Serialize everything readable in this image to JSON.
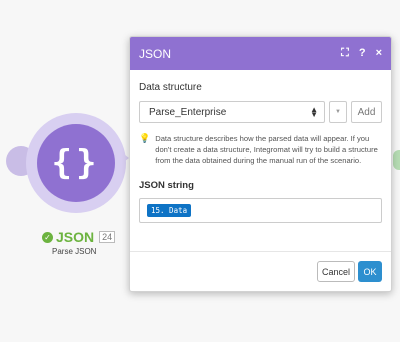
{
  "module": {
    "name": "JSON",
    "id": "24",
    "subtitle": "Parse JSON",
    "icon": "braces-icon"
  },
  "dialog": {
    "title": "JSON",
    "controls": {
      "expand_icon": "⛶",
      "help_icon": "?",
      "close_icon": "×"
    },
    "data_structure": {
      "label": "Data structure",
      "selected": "Parse_Enterprise",
      "add_label": "Add"
    },
    "hint": "Data structure describes how the parsed data will appear. If you don't create a data structure, Integromat will try to build a structure from the data obtained during the manual run of the scenario.",
    "json_string": {
      "label": "JSON string",
      "value": "15. Data"
    },
    "footer": {
      "cancel_label": "Cancel",
      "ok_label": "OK"
    }
  },
  "colors": {
    "accent": "#8f71d1",
    "success": "#6cb33f",
    "primary_button": "#2d8fcf",
    "pill": "#0e73c5"
  }
}
